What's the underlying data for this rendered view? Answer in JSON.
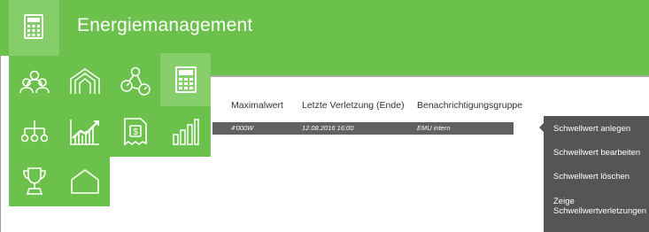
{
  "header": {
    "title": "Energiemanagement",
    "app_icon": "calculator-icon"
  },
  "menu_tiles": [
    {
      "icon": "people-group-icon"
    },
    {
      "icon": "building-arch-icon"
    },
    {
      "icon": "meter-nodes-icon"
    },
    {
      "icon": "calculator-icon",
      "active": true
    },
    {
      "icon": "org-chart-icon"
    },
    {
      "icon": "line-chart-icon"
    },
    {
      "icon": "dollar-document-icon"
    },
    {
      "icon": "bar-chart-icon"
    },
    {
      "icon": "trophy-icon"
    },
    {
      "icon": "house-icon"
    }
  ],
  "table": {
    "columns": [
      "Maximalwert",
      "Letzte Verletzung (Ende)",
      "Benachrichtigungsgruppe"
    ],
    "rows": [
      {
        "max": "4'000W",
        "last_violation": "12.08.2016 16:00",
        "group": "EMU intern"
      }
    ]
  },
  "actions": [
    {
      "label": "Schwellwert anlegen"
    },
    {
      "label": "Schwellwert bearbeiten"
    },
    {
      "label": "Schwellwert löschen"
    },
    {
      "label_line1": "Zeige",
      "label_line2": "Schwellwertverletzungen"
    }
  ],
  "colors": {
    "brand_green": "#6cc14d",
    "active_tile": "#87cf6b",
    "panel_dark": "#555555",
    "row_dark": "#616161"
  }
}
